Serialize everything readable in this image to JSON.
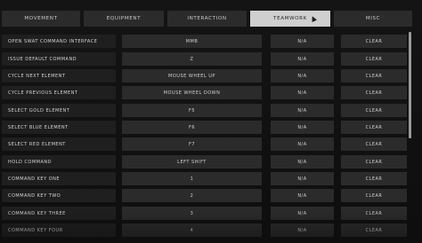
{
  "tabs": [
    {
      "label": "MOVEMENT",
      "active": false
    },
    {
      "label": "EQUIPMENT",
      "active": false
    },
    {
      "label": "INTERACTION",
      "active": false
    },
    {
      "label": "TEAMWORK",
      "active": true
    },
    {
      "label": "MISC",
      "active": false
    }
  ],
  "rows": [
    {
      "label": "OPEN SWAT COMMAND INTERFACE",
      "key": "MMB",
      "alt": "N/A",
      "clear": "CLEAR"
    },
    {
      "label": "ISSUE DEFAULT COMMAND",
      "key": "Z",
      "alt": "N/A",
      "clear": "CLEAR"
    },
    {
      "label": "CYCLE NEXT ELEMENT",
      "key": "MOUSE WHEEL UP",
      "alt": "N/A",
      "clear": "CLEAR"
    },
    {
      "label": "CYCLE PREVIOUS ELEMENT",
      "key": "MOUSE WHEEL DOWN",
      "alt": "N/A",
      "clear": "CLEAR"
    },
    {
      "label": "SELECT GOLD ELEMENT",
      "key": "F5",
      "alt": "N/A",
      "clear": "CLEAR"
    },
    {
      "label": "SELECT BLUE ELEMENT",
      "key": "F6",
      "alt": "N/A",
      "clear": "CLEAR"
    },
    {
      "label": "SELECT RED ELEMENT",
      "key": "F7",
      "alt": "N/A",
      "clear": "CLEAR"
    },
    {
      "label": "HOLD COMMAND",
      "key": "LEFT SHIFT",
      "alt": "N/A",
      "clear": "CLEAR"
    },
    {
      "label": "COMMAND KEY ONE",
      "key": "1",
      "alt": "N/A",
      "clear": "CLEAR"
    },
    {
      "label": "COMMAND KEY TWO",
      "key": "2",
      "alt": "N/A",
      "clear": "CLEAR"
    },
    {
      "label": "COMMAND KEY THREE",
      "key": "3",
      "alt": "N/A",
      "clear": "CLEAR"
    },
    {
      "label": "COMMAND KEY FOUR",
      "key": "4",
      "alt": "N/A",
      "clear": "CLEAR"
    }
  ],
  "colors": {
    "background": "#111111",
    "cell": "#2b2b2b",
    "label_cell": "#1f1f1f",
    "active_tab": "#cfcfcf",
    "text": "#d0d0d0"
  },
  "icons": {
    "cursor": "mouse-pointer-icon"
  }
}
